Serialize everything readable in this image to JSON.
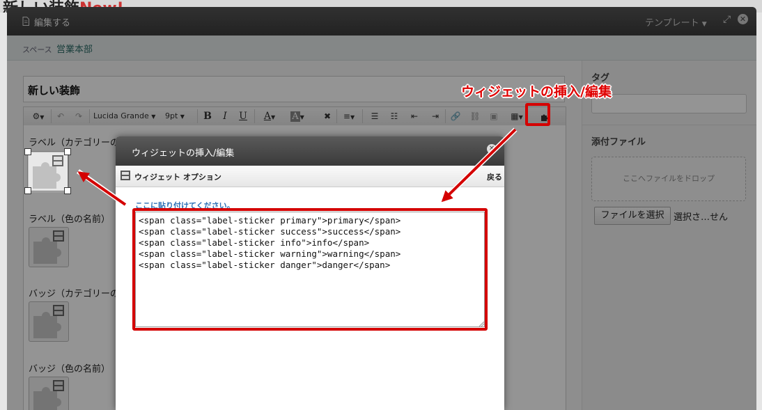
{
  "background": {
    "page_title": "新しい装飾",
    "new_badge": "New!"
  },
  "modal": {
    "title": "編集する",
    "template_label": "テンプレート",
    "expand_glyph": "⤢",
    "close_glyph": "✕"
  },
  "space": {
    "label": "スペース",
    "value": "営業本部"
  },
  "title_input": {
    "value": "新しい装飾"
  },
  "toolbar": {
    "font_family": "Lucida Grande",
    "font_size": "9pt",
    "bold": "B",
    "italic": "I",
    "underline": "U",
    "font_color": "A",
    "highlight": "A",
    "remove_format": "✖"
  },
  "editor": {
    "labels": [
      "ラベル（カテゴリーの名前）",
      "ラベル（色の名前）",
      "バッジ（カテゴリーの",
      "バッジ（色の名前）"
    ]
  },
  "right_panel": {
    "tag_label": "タグ",
    "attachment_label": "添付ファイル",
    "drop_zone": "ここへファイルをドロップ",
    "choose_file_button": "ファイルを選択",
    "no_file_text": "選択さ…せん"
  },
  "widget_dialog": {
    "title": "ウィジェットの挿入/編集",
    "close_glyph": "✕",
    "subtitle": "ウィジェット オプション",
    "back_label": "戻る",
    "hint": "ここに貼り付けてください。",
    "code": "<span class=\"label-sticker primary\">primary</span>\n<span class=\"label-sticker success\">success</span>\n<span class=\"label-sticker info\">info</span>\n<span class=\"label-sticker warning\">warning</span>\n<span class=\"label-sticker danger\">danger</span>"
  },
  "annotation": {
    "label": "ウィジェットの挿入/編集"
  },
  "colors": {
    "callout_red": "#d40000",
    "hint_blue": "#2a6fb5",
    "header_dark": "#3c3c3c"
  }
}
